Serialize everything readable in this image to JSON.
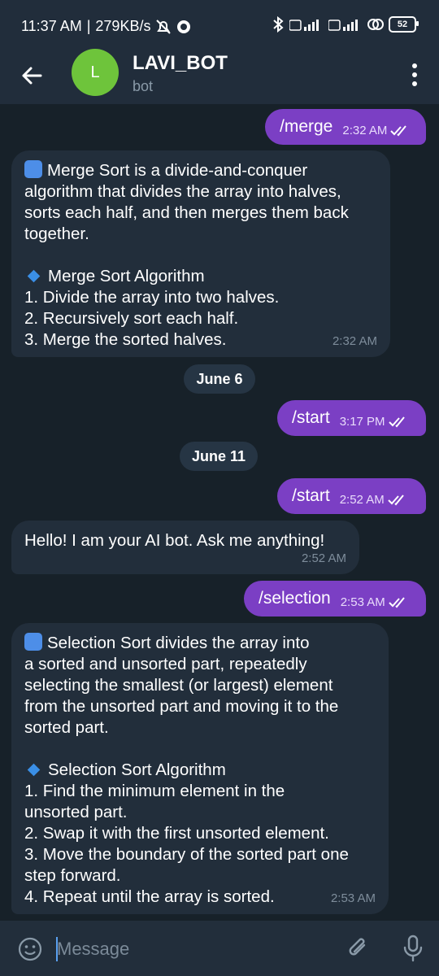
{
  "status_bar": {
    "time": "11:37 AM",
    "speed": "279KB/s",
    "battery": "52"
  },
  "header": {
    "avatar_letter": "L",
    "title": "LAVI_BOT",
    "subtitle": "bot"
  },
  "messages": [
    {
      "text": "/merge",
      "time": "2:32 AM"
    },
    {
      "lines": [
        "Merge Sort is a divide-and-conquer",
        "algorithm that divides the array into halves,",
        "sorts each half, and then merges them back",
        "together.",
        "",
        "Merge Sort Algorithm",
        "1. Divide the array into two halves.",
        "2. Recursively sort each half.",
        "3. Merge the sorted halves."
      ],
      "time": "2:32 AM"
    },
    {
      "date": "June 6"
    },
    {
      "text": "/start",
      "time": "3:17 PM"
    },
    {
      "date": "June 11"
    },
    {
      "text": "/start",
      "time": "2:52 AM"
    },
    {
      "lines": [
        "Hello! I am your AI bot. Ask me anything!"
      ],
      "time": "2:52 AM"
    },
    {
      "text": "/selection",
      "time": "2:53 AM"
    },
    {
      "lines": [
        "Selection Sort divides the array into",
        "a sorted and unsorted part, repeatedly",
        "selecting the smallest (or largest) element",
        "from the unsorted part and moving it to the",
        "sorted part.",
        "",
        "Selection Sort Algorithm",
        "1. Find the minimum element in the",
        "unsorted part.",
        "2. Swap it with the first unsorted element.",
        "3. Move the boundary of the sorted part one",
        "step forward.",
        "4. Repeat until the array is sorted."
      ],
      "time": "2:53 AM"
    }
  ],
  "input": {
    "placeholder": "Message"
  },
  "colors": {
    "outgoing_bubble": "#7b3fc4",
    "incoming_bubble": "#222e3b",
    "avatar": "#6ec43b",
    "header": "#212d3b"
  }
}
